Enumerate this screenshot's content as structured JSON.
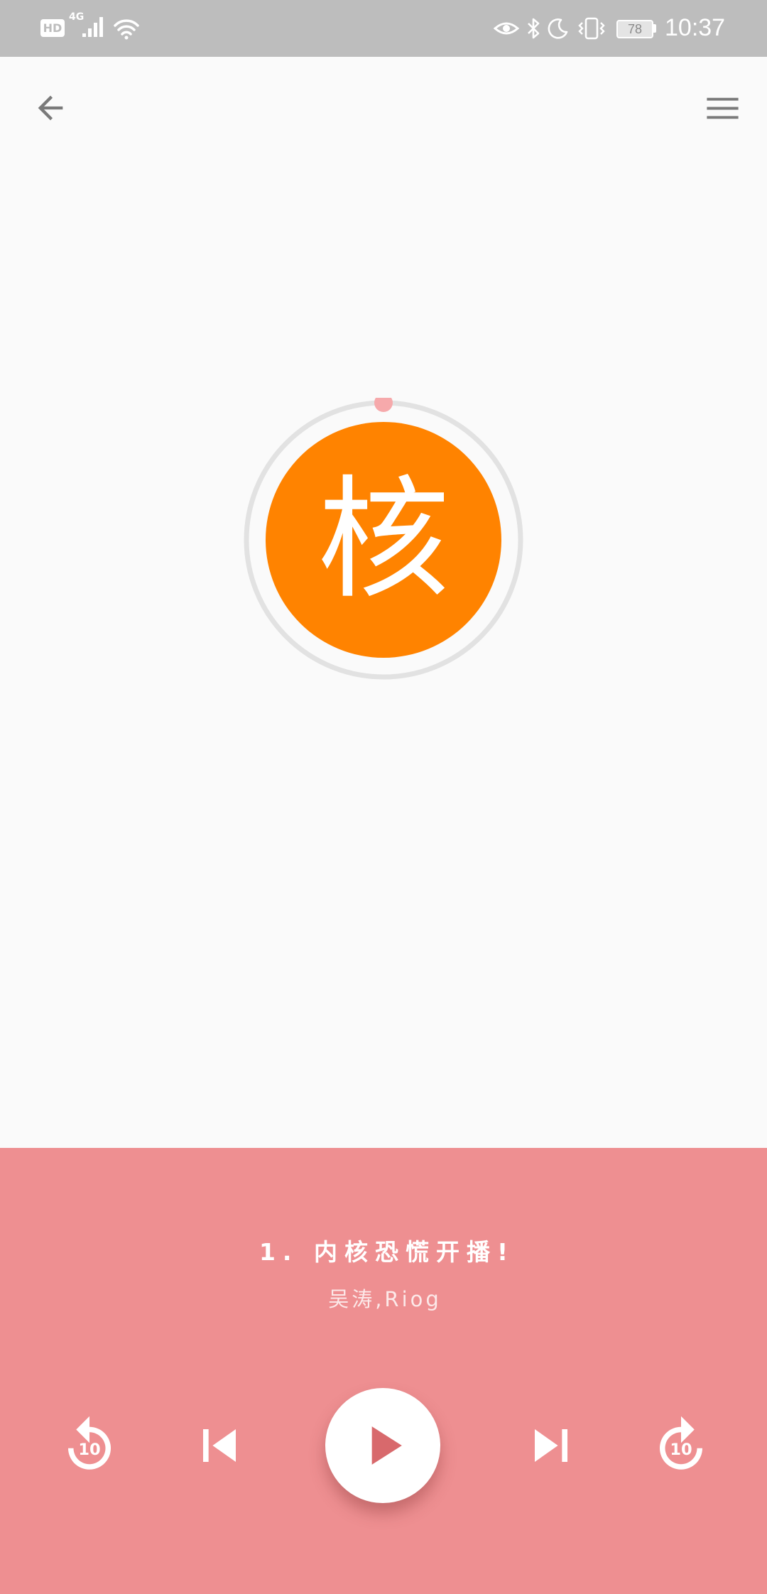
{
  "status_bar": {
    "background": "#bdbdbd",
    "hd_badge": "HD",
    "network_type": "4G",
    "battery_percent": "78",
    "time": "10:37",
    "left_icons": [
      "hd-icon",
      "signal-icon",
      "wifi-icon"
    ],
    "right_icons": [
      "eye-comfort-icon",
      "bluetooth-icon",
      "moon-icon",
      "vibrate-icon",
      "battery-icon"
    ]
  },
  "app_bar": {
    "back_icon": "arrow-back-icon",
    "menu_icon": "menu-icon"
  },
  "cover": {
    "glyph": "核",
    "disc_color": "#ff8300",
    "ring_color": "#e2e2e2",
    "marker_color": "#f6a9ab",
    "progress": 0
  },
  "player": {
    "background": "#ee8f91",
    "accent_color": "#d8696c",
    "title": "1. 内核恐慌开播!",
    "artist": "吴涛,Riog",
    "controls": {
      "rewind": {
        "icon": "replay-10-icon",
        "seconds": "10"
      },
      "previous": {
        "icon": "skip-previous-icon"
      },
      "play": {
        "icon": "play-icon"
      },
      "next": {
        "icon": "skip-next-icon"
      },
      "forward": {
        "icon": "forward-10-icon",
        "seconds": "10"
      }
    }
  }
}
